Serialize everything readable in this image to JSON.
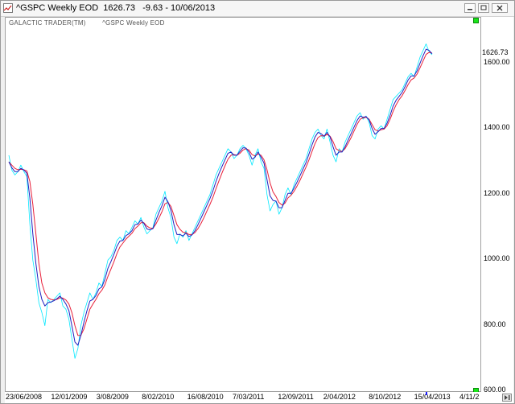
{
  "window": {
    "title": "^GSPC Weekly EOD  1626.73   -9.63 - 10/06/2013"
  },
  "chart_header": {
    "brand": "GALACTIC TRADER(TM)",
    "series_label": "^GSPC Weekly EOD"
  },
  "colors": {
    "price": "#00e8ff",
    "fast_ma": "#2020c0",
    "slow_ma": "#e8203a"
  },
  "chart_data": {
    "type": "line",
    "y_ticks": [
      "600.00",
      "800.00",
      "1000.00",
      "1200.00",
      "1400.00",
      "1600.00"
    ],
    "last_value_label": "1626.73",
    "x_ticks": [
      "23/06/2008",
      "12/01/2009",
      "3/08/2009",
      "8/02/2010",
      "16/08/2010",
      "7/03/2011",
      "12/09/2011",
      "2/04/2012",
      "8/10/2012",
      "15/04/2013",
      "4/11/2"
    ],
    "ylim": [
      600,
      1740
    ],
    "grid": false,
    "series": [
      {
        "values": [
          1320,
          1275,
          1260,
          1270,
          1290,
          1270,
          1255,
          1110,
          1000,
          940,
          870,
          840,
          800,
          880,
          870,
          880,
          890,
          900,
          860,
          850,
          820,
          760,
          700,
          730,
          800,
          840,
          870,
          900,
          880,
          900,
          930,
          920,
          960,
          1000,
          1010,
          1030,
          1060,
          1070,
          1060,
          1090,
          1080,
          1100,
          1120,
          1110,
          1130,
          1100,
          1080,
          1090,
          1100,
          1140,
          1160,
          1180,
          1210,
          1160,
          1130,
          1070,
          1050,
          1080,
          1070,
          1090,
          1060,
          1080,
          1100,
          1120,
          1140,
          1160,
          1180,
          1200,
          1230,
          1260,
          1280,
          1300,
          1320,
          1340,
          1330,
          1310,
          1320,
          1340,
          1350,
          1340,
          1320,
          1290,
          1320,
          1340,
          1300,
          1280,
          1200,
          1150,
          1170,
          1180,
          1140,
          1160,
          1200,
          1220,
          1200,
          1230,
          1250,
          1270,
          1290,
          1310,
          1340,
          1370,
          1390,
          1400,
          1380,
          1370,
          1400,
          1360,
          1320,
          1300,
          1340,
          1330,
          1360,
          1380,
          1400,
          1420,
          1440,
          1450,
          1430,
          1440,
          1420,
          1380,
          1370,
          1400,
          1410,
          1400,
          1430,
          1460,
          1490,
          1500,
          1510,
          1520,
          1540,
          1560,
          1570,
          1560,
          1590,
          1620,
          1640,
          1660,
          1636,
          1626.73
        ]
      },
      {
        "values": [
          1300,
          1282,
          1270,
          1270,
          1280,
          1275,
          1265,
          1190,
          1080,
          990,
          920,
          880,
          860,
          870,
          872,
          876,
          882,
          890,
          880,
          866,
          846,
          800,
          750,
          740,
          770,
          810,
          845,
          875,
          880,
          892,
          912,
          918,
          942,
          975,
          995,
          1018,
          1042,
          1058,
          1060,
          1075,
          1080,
          1090,
          1108,
          1110,
          1122,
          1112,
          1095,
          1092,
          1096,
          1122,
          1145,
          1166,
          1192,
          1178,
          1152,
          1108,
          1078,
          1078,
          1074,
          1082,
          1072,
          1077,
          1090,
          1108,
          1128,
          1148,
          1168,
          1188,
          1212,
          1240,
          1264,
          1286,
          1306,
          1326,
          1330,
          1320,
          1320,
          1332,
          1343,
          1342,
          1330,
          1308,
          1314,
          1330,
          1314,
          1296,
          1246,
          1196,
          1182,
          1180,
          1160,
          1160,
          1182,
          1204,
          1204,
          1220,
          1238,
          1258,
          1278,
          1298,
          1324,
          1352,
          1376,
          1390,
          1386,
          1378,
          1390,
          1376,
          1346,
          1320,
          1330,
          1330,
          1346,
          1366,
          1386,
          1406,
          1426,
          1440,
          1436,
          1438,
          1428,
          1402,
          1384,
          1392,
          1402,
          1402,
          1418,
          1442,
          1470,
          1488,
          1500,
          1512,
          1530,
          1550,
          1562,
          1562,
          1578,
          1602,
          1624,
          1644,
          1640,
          1630
        ]
      },
      {
        "values": [
          1300,
          1290,
          1280,
          1276,
          1277,
          1276,
          1272,
          1240,
          1170,
          1080,
          990,
          930,
          900,
          885,
          880,
          878,
          880,
          885,
          884,
          878,
          866,
          840,
          800,
          770,
          770,
          790,
          820,
          850,
          866,
          880,
          897,
          908,
          925,
          950,
          972,
          995,
          1020,
          1040,
          1052,
          1064,
          1073,
          1082,
          1096,
          1104,
          1114,
          1114,
          1104,
          1098,
          1097,
          1110,
          1128,
          1148,
          1172,
          1176,
          1164,
          1136,
          1108,
          1094,
          1085,
          1084,
          1078,
          1078,
          1084,
          1096,
          1112,
          1130,
          1150,
          1170,
          1192,
          1218,
          1242,
          1266,
          1288,
          1308,
          1320,
          1322,
          1320,
          1326,
          1336,
          1340,
          1336,
          1322,
          1318,
          1324,
          1320,
          1306,
          1276,
          1236,
          1208,
          1194,
          1176,
          1168,
          1174,
          1190,
          1198,
          1210,
          1226,
          1244,
          1264,
          1284,
          1306,
          1332,
          1356,
          1374,
          1380,
          1378,
          1384,
          1378,
          1362,
          1340,
          1334,
          1332,
          1340,
          1356,
          1374,
          1394,
          1414,
          1430,
          1434,
          1436,
          1430,
          1414,
          1398,
          1394,
          1398,
          1400,
          1410,
          1430,
          1454,
          1474,
          1490,
          1502,
          1518,
          1536,
          1550,
          1556,
          1568,
          1588,
          1608,
          1628,
          1634,
          1632
        ]
      }
    ]
  }
}
